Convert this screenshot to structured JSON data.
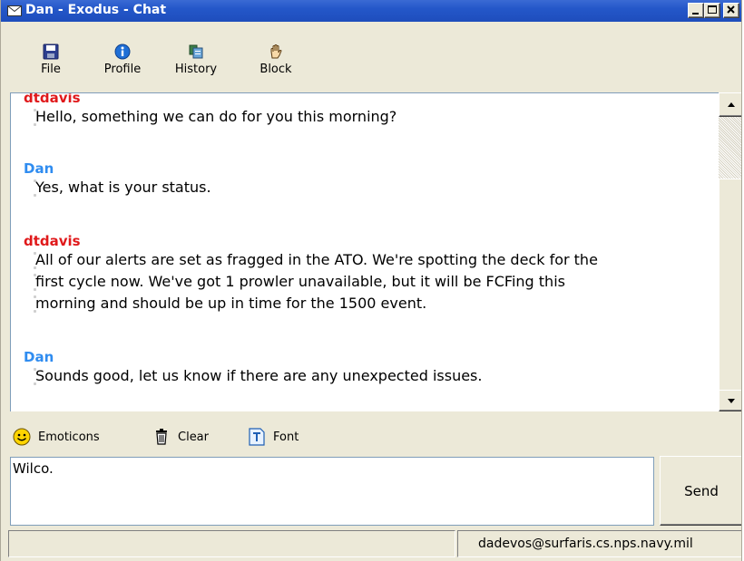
{
  "window": {
    "title": "Dan - Exodus - Chat"
  },
  "toolbar": {
    "items": [
      {
        "label": "File",
        "icon": "save-disk-icon"
      },
      {
        "label": "Profile",
        "icon": "info-icon"
      },
      {
        "label": "History",
        "icon": "history-icon"
      },
      {
        "label": "Block",
        "icon": "hand-icon"
      }
    ]
  },
  "chat": {
    "messages": [
      {
        "sender": "dtdavis",
        "lines": [
          "Hello, something we can do for you this morning?"
        ]
      },
      {
        "sender": "Dan",
        "lines": [
          "Yes, what is your status."
        ]
      },
      {
        "sender": "dtdavis",
        "lines": [
          "All of our alerts are set as fragged in the ATO.  We're spotting the deck for the",
          "first cycle now.  We've got 1 prowler unavailable, but it will be FCFing this",
          "morning and should be up in time for the 1500 event."
        ]
      },
      {
        "sender": "Dan",
        "lines": [
          "Sounds good, let us know if there are any unexpected issues."
        ]
      }
    ]
  },
  "lower_toolbar": {
    "emoticons_label": "Emoticons",
    "clear_label": "Clear",
    "font_label": "Font"
  },
  "compose": {
    "value": "Wilco."
  },
  "send_label": "Send",
  "status": {
    "left_text": "",
    "right_text": "dadevos@surfaris.cs.nps.navy.mil"
  },
  "colors": {
    "title_bar": "#2457c9",
    "sender_local": "#e0191b",
    "sender_remote": "#2f8cf0"
  }
}
